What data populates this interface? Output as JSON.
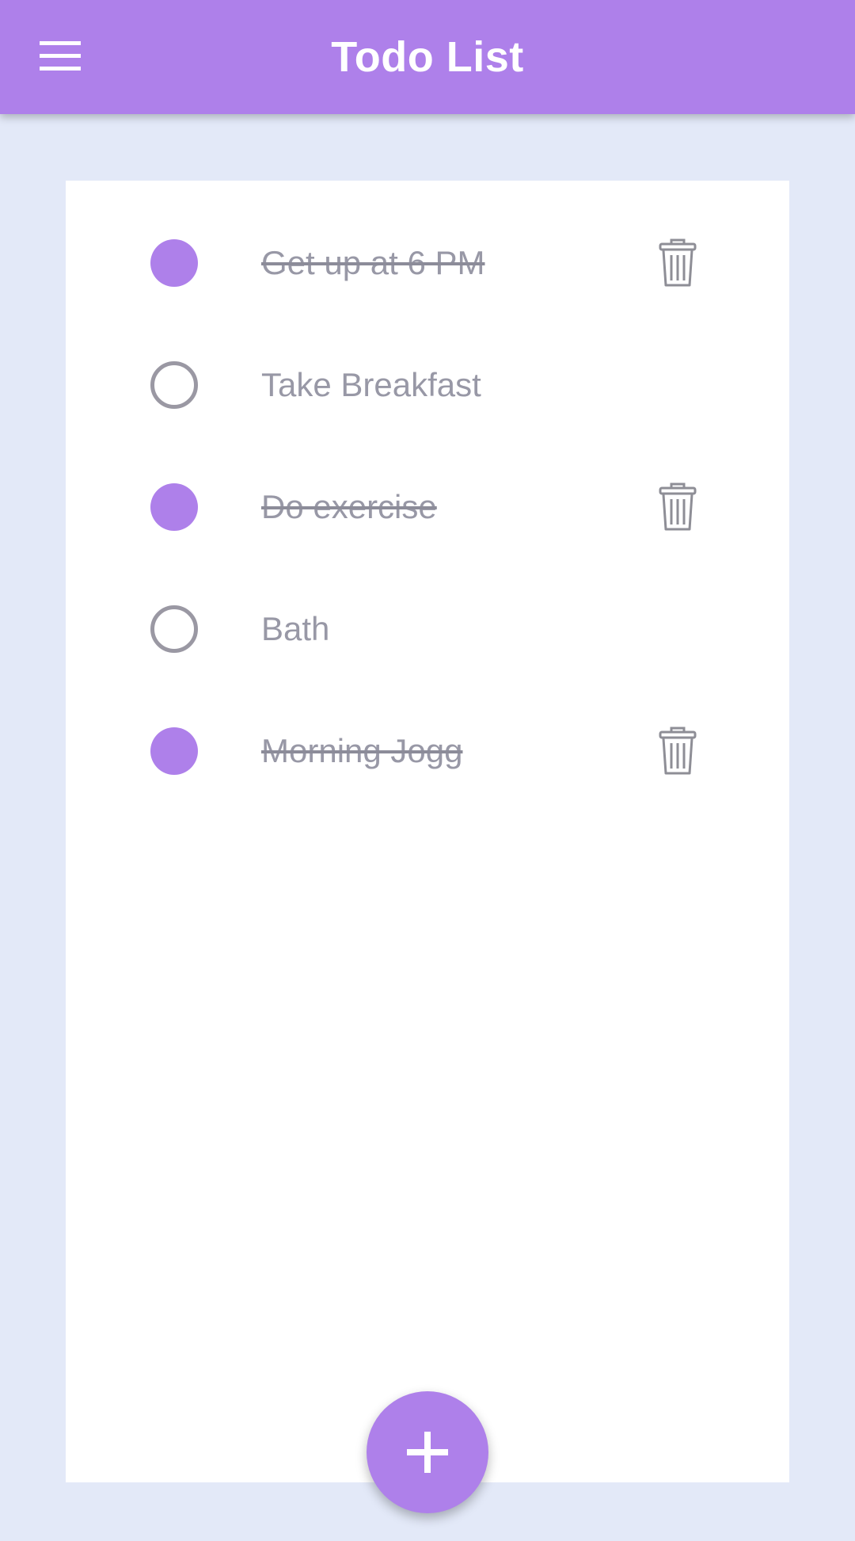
{
  "app_bar": {
    "title": "Todo List",
    "menu_icon": "hamburger-menu-icon",
    "color": "#ae80ea"
  },
  "todos": [
    {
      "label": "Get up at 6 PM",
      "completed": true
    },
    {
      "label": "Take Breakfast",
      "completed": false
    },
    {
      "label": "Do exercise",
      "completed": true
    },
    {
      "label": "Bath",
      "completed": false
    },
    {
      "label": "Morning Jogg",
      "completed": true
    }
  ],
  "icons": {
    "delete": "trash-icon",
    "add": "plus-icon"
  },
  "colors": {
    "accent": "#ae80ea",
    "background": "#e3e9f8",
    "card": "#ffffff",
    "text": "#9898a6"
  }
}
